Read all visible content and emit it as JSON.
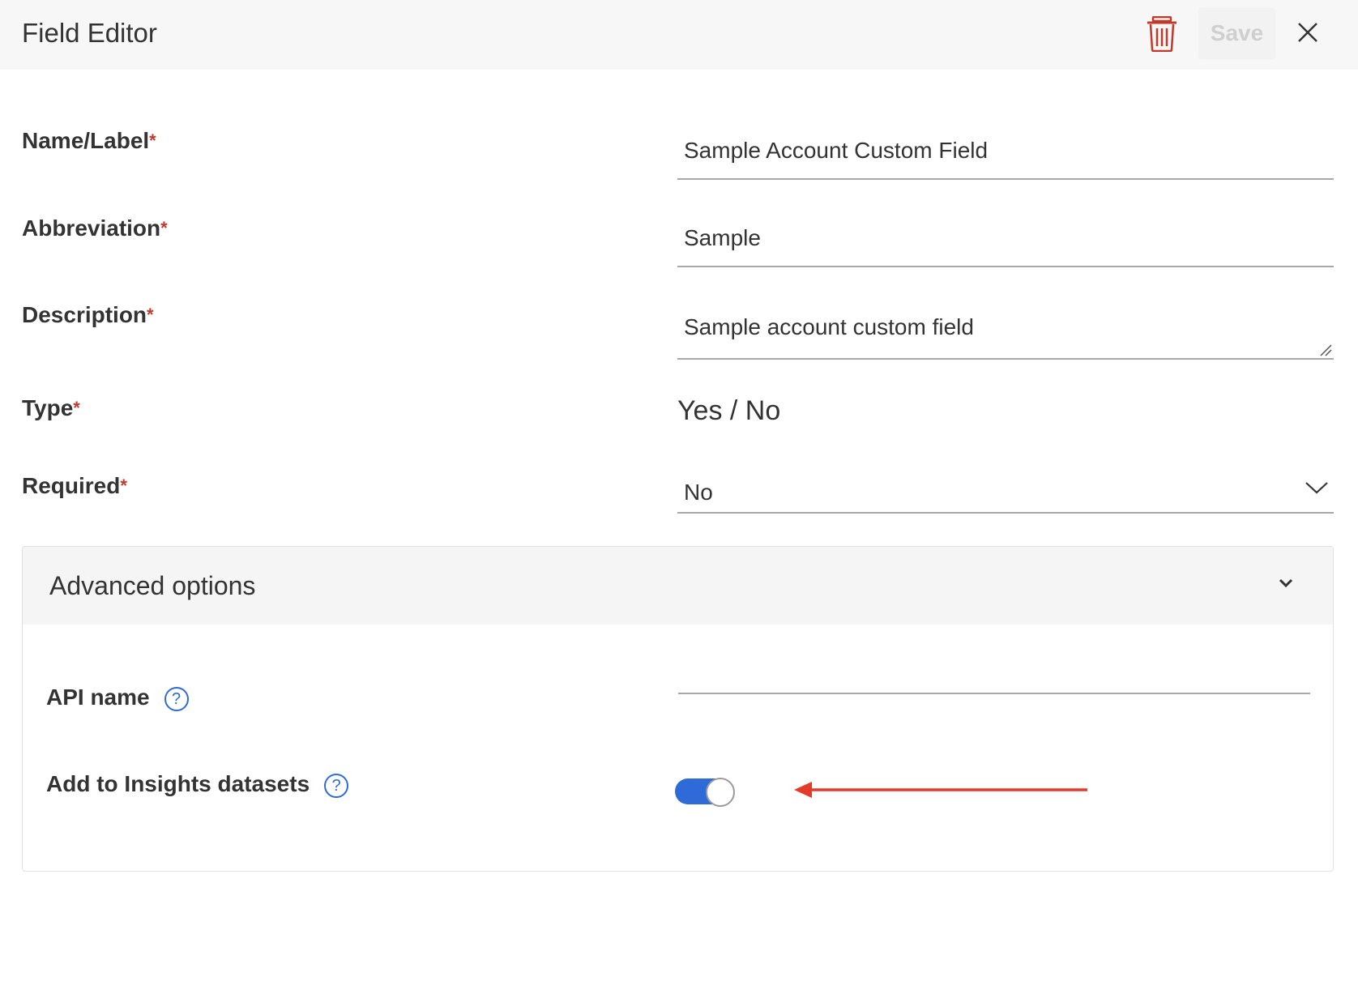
{
  "header": {
    "title": "Field Editor",
    "save_label": "Save",
    "delete_icon": "trash-icon",
    "close_icon": "close-icon"
  },
  "fields": {
    "name": {
      "label": "Name/Label",
      "required_mark": "*",
      "value": "Sample Account Custom Field"
    },
    "abbreviation": {
      "label": "Abbreviation",
      "required_mark": "*",
      "value": "Sample"
    },
    "description": {
      "label": "Description",
      "required_mark": "*",
      "value": "Sample account custom field"
    },
    "type": {
      "label": "Type",
      "required_mark": "*",
      "value": "Yes / No"
    },
    "required": {
      "label": "Required",
      "required_mark": "*",
      "value": "No"
    }
  },
  "advanced": {
    "title": "Advanced options",
    "api_name": {
      "label": "API name",
      "help": "?",
      "value": ""
    },
    "insights": {
      "label": "Add to Insights datasets",
      "help": "?",
      "enabled": true
    }
  },
  "colors": {
    "accent": "#2f6bd8",
    "required": "#c0392b",
    "delete": "#c0392b",
    "annotation_arrow": "#e53a2a"
  }
}
